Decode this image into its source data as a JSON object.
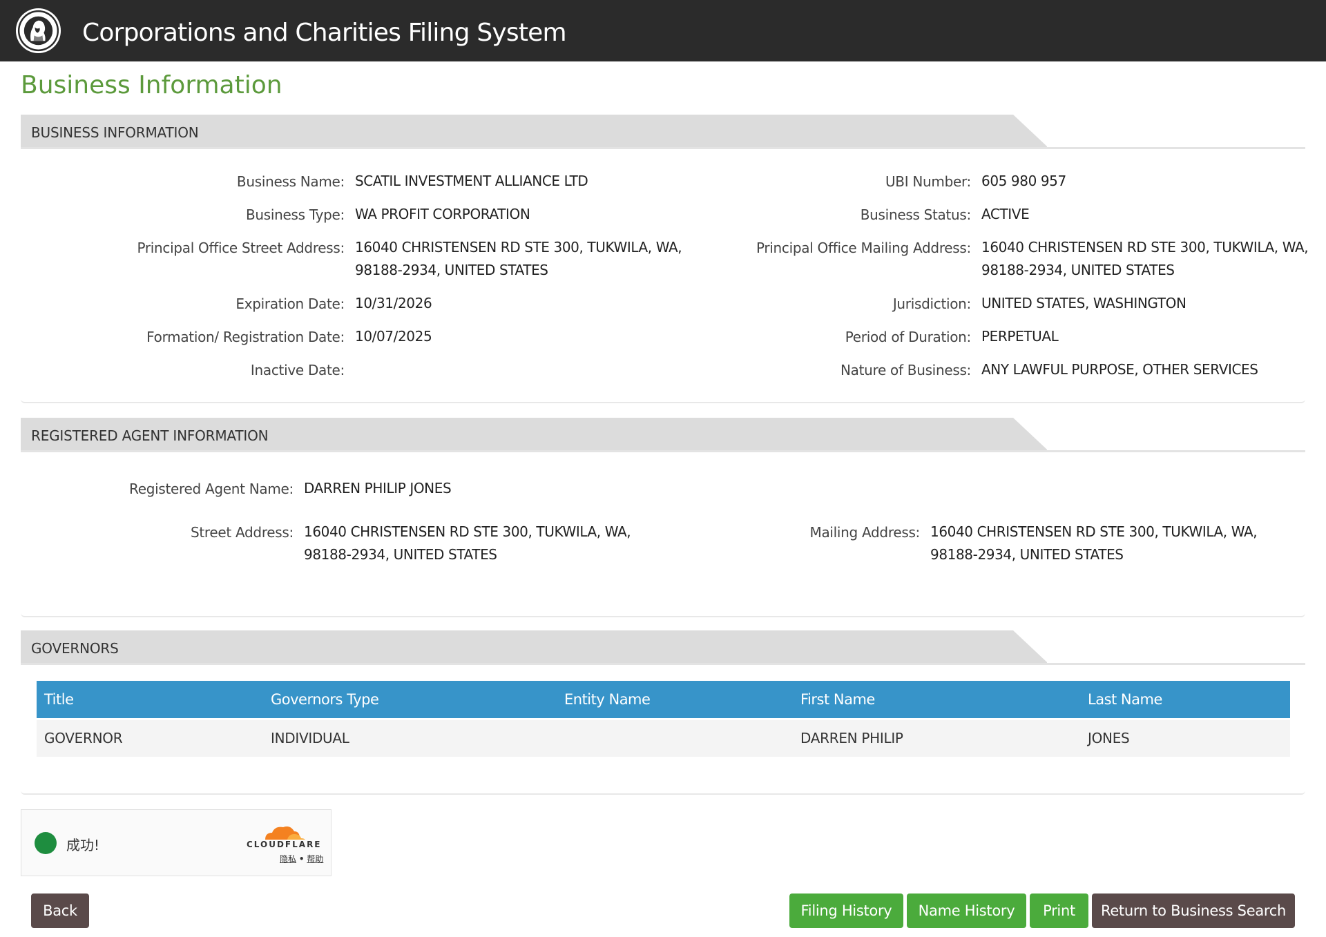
{
  "header": {
    "app_title": "Corporations and Charities Filing System",
    "seal_icon": "washington-state-seal"
  },
  "page_title": "Business Information",
  "business_info": {
    "section_label": "BUSINESS INFORMATION",
    "left": [
      {
        "label": "Business Name:",
        "value": [
          "SCATIL INVESTMENT ALLIANCE LTD"
        ]
      },
      {
        "label": "Business Type:",
        "value": [
          "WA PROFIT CORPORATION"
        ]
      },
      {
        "label": "Principal Office Street Address:",
        "value": [
          "16040 CHRISTENSEN RD STE 300, TUKWILA, WA,",
          "98188-2934, UNITED STATES"
        ]
      },
      {
        "label": "Expiration Date:",
        "value": [
          "10/31/2026"
        ]
      },
      {
        "label": "Formation/ Registration Date:",
        "value": [
          "10/07/2025"
        ]
      },
      {
        "label": "Inactive Date:",
        "value": [
          ""
        ]
      }
    ],
    "right": [
      {
        "label": "UBI Number:",
        "value": [
          "605 980 957"
        ]
      },
      {
        "label": "Business Status:",
        "value": [
          "ACTIVE"
        ]
      },
      {
        "label": "Principal Office Mailing Address:",
        "value": [
          "16040 CHRISTENSEN RD STE 300, TUKWILA, WA,",
          "98188-2934, UNITED STATES"
        ]
      },
      {
        "label": "Jurisdiction:",
        "value": [
          "UNITED STATES, WASHINGTON"
        ]
      },
      {
        "label": "Period of Duration:",
        "value": [
          "PERPETUAL"
        ]
      },
      {
        "label": "Nature of Business:",
        "value": [
          "ANY LAWFUL PURPOSE, OTHER SERVICES"
        ]
      }
    ]
  },
  "agent_info": {
    "section_label": "REGISTERED AGENT INFORMATION",
    "name_label": "Registered Agent Name:",
    "name_value": "DARREN PHILIP JONES",
    "street_label": "Street Address:",
    "street_value": [
      "16040 CHRISTENSEN RD STE 300, TUKWILA, WA,",
      "98188-2934, UNITED STATES"
    ],
    "mailing_label": "Mailing Address:",
    "mailing_value": [
      "16040 CHRISTENSEN RD STE 300, TUKWILA, WA,",
      "98188-2934, UNITED STATES"
    ]
  },
  "governors": {
    "section_label": "GOVERNORS",
    "columns": [
      "Title",
      "Governors Type",
      "Entity Name",
      "First Name",
      "Last Name"
    ],
    "rows": [
      [
        "GOVERNOR",
        "INDIVIDUAL",
        "",
        "DARREN PHILIP",
        "JONES"
      ]
    ]
  },
  "captcha": {
    "status_text": "成功!",
    "brand": "CLOUDFLARE",
    "privacy_link": "隐私",
    "separator": "•",
    "help_link": "帮助",
    "status_color": "#1e8d3f"
  },
  "actions": {
    "back": "Back",
    "filing_history": "Filing History",
    "name_history": "Name History",
    "print": "Print",
    "return_search": "Return to Business Search"
  },
  "colors": {
    "header_bg": "#2b2b2b",
    "title_green": "#5c9a3c",
    "table_header_blue": "#3794c9",
    "button_green": "#4bab3c",
    "button_dark": "#5a4a4a"
  }
}
